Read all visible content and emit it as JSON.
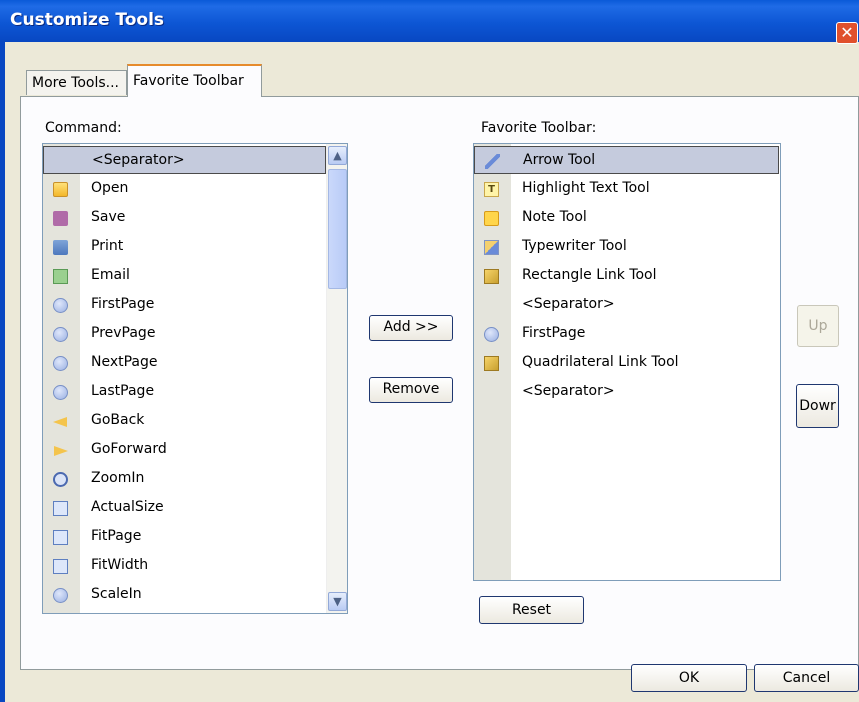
{
  "window": {
    "title": "Customize Tools",
    "close_glyph": "✕"
  },
  "tabs": [
    {
      "label": "More Tools..."
    },
    {
      "label": "Favorite Toolbar"
    }
  ],
  "command_label": "Command:",
  "favorite_label": "Favorite Toolbar:",
  "commands": [
    {
      "label": "<Separator>",
      "icon": "none"
    },
    {
      "label": "Open",
      "icon": "folder-icon"
    },
    {
      "label": "Save",
      "icon": "save-icon"
    },
    {
      "label": "Print",
      "icon": "print-icon"
    },
    {
      "label": "Email",
      "icon": "email-icon"
    },
    {
      "label": "FirstPage",
      "icon": "first-page-icon"
    },
    {
      "label": "PrevPage",
      "icon": "prev-page-icon"
    },
    {
      "label": "NextPage",
      "icon": "next-page-icon"
    },
    {
      "label": "LastPage",
      "icon": "last-page-icon"
    },
    {
      "label": "GoBack",
      "icon": "go-back-icon"
    },
    {
      "label": "GoForward",
      "icon": "go-forward-icon"
    },
    {
      "label": "ZoomIn",
      "icon": "zoom-in-icon"
    },
    {
      "label": "ActualSize",
      "icon": "actual-size-icon"
    },
    {
      "label": "FitPage",
      "icon": "fit-page-icon"
    },
    {
      "label": "FitWidth",
      "icon": "fit-width-icon"
    },
    {
      "label": "ScaleIn",
      "icon": "scale-in-icon"
    }
  ],
  "favorites": [
    {
      "label": "Arrow Tool",
      "icon": "arrow-tool-icon"
    },
    {
      "label": "Highlight Text Tool",
      "icon": "highlight-text-icon"
    },
    {
      "label": "Note Tool",
      "icon": "note-icon"
    },
    {
      "label": "Typewriter Tool",
      "icon": "typewriter-icon"
    },
    {
      "label": "Rectangle Link Tool",
      "icon": "rectangle-link-icon"
    },
    {
      "label": "<Separator>",
      "icon": "none"
    },
    {
      "label": "FirstPage",
      "icon": "first-page-icon"
    },
    {
      "label": "Quadrilateral Link Tool",
      "icon": "quadrilateral-link-icon"
    },
    {
      "label": "<Separator>",
      "icon": "none"
    }
  ],
  "buttons": {
    "add": "Add >>",
    "remove": "Remove",
    "up": "Up",
    "down": "Dowr",
    "reset": "Reset",
    "ok": "OK",
    "cancel": "Cancel"
  }
}
